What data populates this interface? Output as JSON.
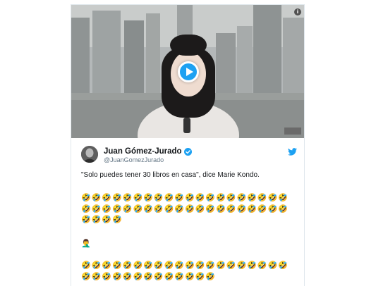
{
  "video": {
    "info_icon_glyph": "i",
    "play_icon": "play-icon"
  },
  "tweet": {
    "display_name": "Juan Gómez-Jurado",
    "handle": "@JuanGomezJurado",
    "verified": true,
    "text": "\"Solo puedes tener 30 libros en casa\", dice Marie Kondo.",
    "emoji_block_1": "🤣🤣🤣🤣🤣🤣🤣🤣🤣🤣🤣🤣🤣🤣🤣🤣🤣🤣🤣🤣🤣🤣🤣🤣🤣🤣🤣🤣🤣🤣🤣🤣🤣🤣🤣🤣🤣🤣🤣🤣🤣🤣🤣🤣",
    "person_emoji": "🤦‍♂️",
    "emoji_block_2": "🤣🤣🤣🤣🤣🤣🤣🤣🤣🤣🤣🤣🤣🤣🤣🤣🤣🤣🤣🤣🤣🤣🤣🤣🤣🤣🤣🤣🤣🤣🤣🤣🤣"
  },
  "colors": {
    "twitter_blue": "#1da1f2",
    "text_primary": "#14171a",
    "text_secondary": "#657786"
  }
}
